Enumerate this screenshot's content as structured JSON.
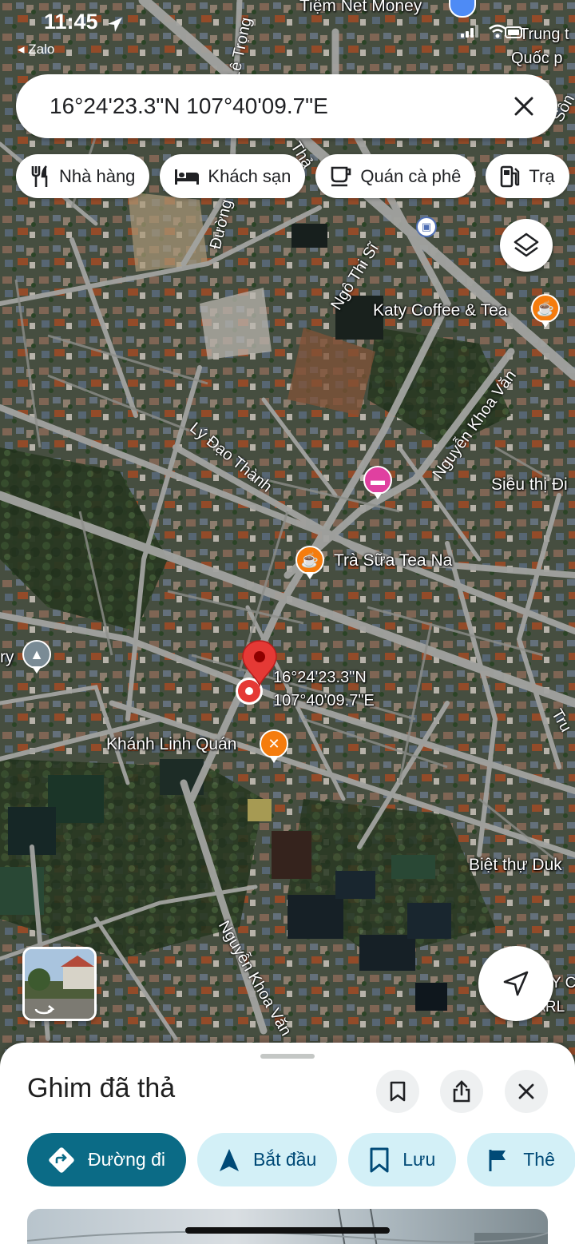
{
  "status_bar": {
    "time": "11:45",
    "back_app": "◂ Zalo"
  },
  "search": {
    "query": "16°24'23.3\"N 107°40'09.7\"E",
    "close_icon": "close-icon"
  },
  "chips": [
    {
      "label": "Nhà hàng",
      "icon": "fork-knife-icon"
    },
    {
      "label": "Khách sạn",
      "icon": "bed-icon"
    },
    {
      "label": "Quán cà phê",
      "icon": "coffee-icon"
    },
    {
      "label": "Trạ",
      "icon": "gas-station-icon"
    }
  ],
  "map": {
    "places": {
      "tiem_net": "Tiệm Net Money",
      "trung_tam": "Trung t",
      "quoc": "Quốc p",
      "katy": "Katy Coffee & Tea",
      "sieu_thi": "Siêu thị Đi",
      "tra_sua": "Trà Sữa Tea Na",
      "khanh_linh": "Khánh Linh Quán",
      "biet_thu": "Biệt thự Duk",
      "ry": "ry",
      "right_edge_1": "Y C",
      "right_edge_2": "TARL"
    },
    "streets": {
      "le_trong": "Lê Trọng",
      "duong_ch": "Đường Ch",
      "thai": "Thả",
      "son": "Sôn",
      "ngo_thi_si": "Ngô Thi Sĩ",
      "ly_dao_thanh": "Lý Đạo Thành",
      "nguyen_khoa_van_1": "Nguyễn Khoa Văn",
      "nguyen_khoa_van_2": "Nguyễn Khoa Văn",
      "tru": "Tru"
    },
    "pin": {
      "lat": "16°24'23.3\"N",
      "lng": "107°40'09.7\"E"
    }
  },
  "sheet": {
    "title": "Ghim đã thả",
    "actions": [
      {
        "label": "Đường đi",
        "icon": "directions-icon"
      },
      {
        "label": "Bắt đầu",
        "icon": "navigation-arrow-icon"
      },
      {
        "label": "Lưu",
        "icon": "bookmark-icon"
      },
      {
        "label": "Thê",
        "icon": "flag-icon"
      }
    ]
  },
  "colors": {
    "accent": "#0b6b86",
    "pin_red": "#e53935",
    "poi_orange": "#f57c0e",
    "poi_pink": "#e040a0"
  }
}
